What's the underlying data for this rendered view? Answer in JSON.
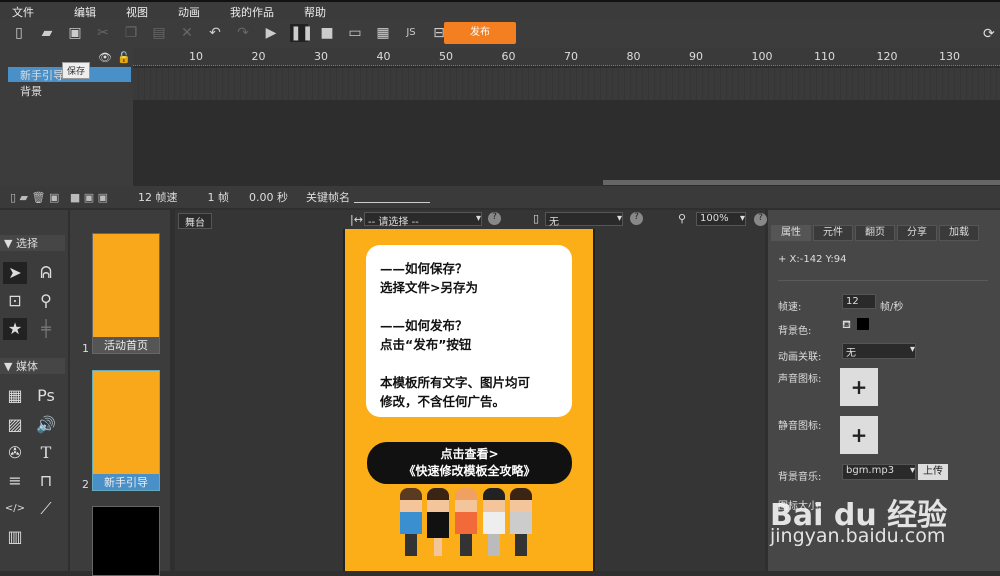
{
  "menu": [
    "文件",
    "编辑",
    "视图",
    "动画",
    "我的作品",
    "帮助"
  ],
  "toolbar": {
    "publish": "发布",
    "tooltip": "保存"
  },
  "ruler": [
    "10",
    "20",
    "30",
    "40",
    "50",
    "60",
    "70",
    "80",
    "90",
    "100",
    "110",
    "120",
    "130"
  ],
  "layers": [
    "新手引导",
    "背景"
  ],
  "timeline": {
    "fps": "12 帧速",
    "frame": "1 帧",
    "time": "0.00 秒",
    "keyframe_label": "关键帧名"
  },
  "left": {
    "select_section": "▼ 选择",
    "media_section": "▼ 媒体"
  },
  "pages": [
    {
      "num": "1",
      "label": "活动首页"
    },
    {
      "num": "2",
      "label": "新手引导"
    }
  ],
  "stage": {
    "tab": "舞台",
    "align_select": "-- 请选择 --",
    "device_select": "无",
    "zoom": "100%",
    "card_lines": [
      "——如何保存？",
      "选择文件>另存为",
      "",
      "——如何发布？",
      "点击“发布”按钮",
      "",
      "本模板所有文字、图片均可",
      "修改，不含任何广告。"
    ],
    "bubble_lines": [
      "点击查看>",
      "《快速修改模板全攻略》"
    ]
  },
  "right": {
    "tabs": [
      "属性",
      "元件",
      "翻页",
      "分享",
      "加载"
    ],
    "coords": "+   X:-142    Y:94",
    "fps_label": "帧速:",
    "fps_value": "12",
    "fps_unit": "帧/秒",
    "bg_color_label": "背景色:",
    "anim_label": "动画关联:",
    "anim_value": "无",
    "sound_icon_label": "声音图标:",
    "mute_icon_label": "静音图标:",
    "music_label": "背景音乐:",
    "music_value": "bgm.mp3",
    "upload": "上传",
    "icon_size_label": "图标大小:"
  },
  "watermark": {
    "brand": "Bai du 经验",
    "url": "jingyan.baidu.com"
  },
  "colors": {
    "accent": "#f47f20",
    "stage": "#fbae17",
    "selected": "#4a90c8"
  }
}
